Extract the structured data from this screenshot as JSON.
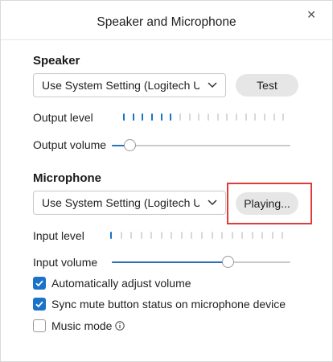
{
  "dialog": {
    "title": "Speaker and Microphone"
  },
  "speaker": {
    "heading": "Speaker",
    "device": "Use System Setting (Logitech U...",
    "test_label": "Test",
    "output_level_label": "Output level",
    "output_level": {
      "active": 6,
      "total": 18
    },
    "output_volume_label": "Output volume",
    "output_volume": 0.1
  },
  "microphone": {
    "heading": "Microphone",
    "device": "Use System Setting (Logitech U...",
    "playing_label": "Playing...",
    "input_level_label": "Input level",
    "input_level": {
      "active": 1,
      "total": 18
    },
    "input_volume_label": "Input volume",
    "input_volume": 0.65
  },
  "options": [
    {
      "label": "Automatically adjust volume",
      "checked": true
    },
    {
      "label": "Sync mute button status on microphone device",
      "checked": true
    },
    {
      "label": "Music mode",
      "checked": false
    }
  ],
  "colors": {
    "accent": "#1a73c8",
    "highlight": "#e03c3c"
  },
  "icons": {
    "close": "close-icon",
    "dropdown": "chevron-down-icon",
    "info": "info-icon",
    "check": "checkmark-icon"
  }
}
